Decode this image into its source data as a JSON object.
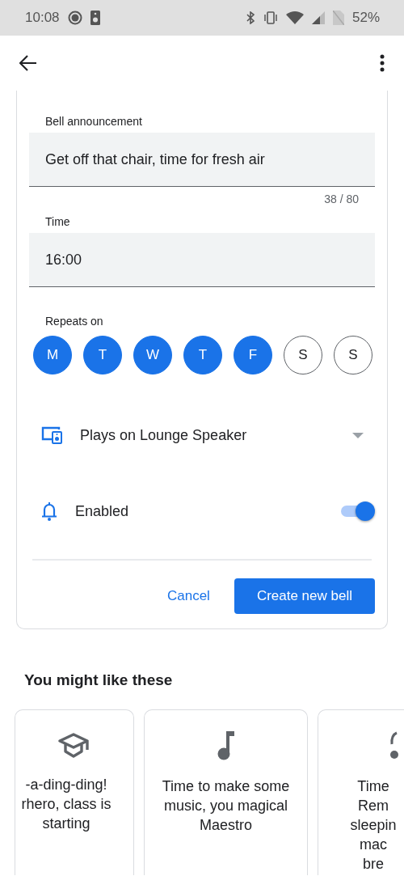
{
  "status_bar": {
    "time": "10:08",
    "battery": "52%"
  },
  "form": {
    "announcement": {
      "label": "Bell announcement",
      "value": "Get off that chair, time for fresh air",
      "counter": "38 / 80"
    },
    "time": {
      "label": "Time",
      "value": "16:00"
    },
    "repeats": {
      "label": "Repeats on",
      "days": [
        {
          "label": "M",
          "selected": true
        },
        {
          "label": "T",
          "selected": true
        },
        {
          "label": "W",
          "selected": true
        },
        {
          "label": "T",
          "selected": true
        },
        {
          "label": "F",
          "selected": true
        },
        {
          "label": "S",
          "selected": false
        },
        {
          "label": "S",
          "selected": false
        }
      ]
    },
    "speaker": {
      "label": "Plays on Lounge Speaker"
    },
    "enabled": {
      "label": "Enabled",
      "on": true
    },
    "buttons": [
      {
        "label": "Cancel",
        "kind": "text"
      },
      {
        "label": "Create new bell",
        "kind": "filled"
      }
    ]
  },
  "suggestions": {
    "title": "You might like these",
    "cards": [
      {
        "lines": [
          "-a-ding-ding!",
          "rhero, class is",
          "starting"
        ]
      },
      {
        "lines": [
          "Time to make some",
          "music, you magical",
          "Maestro"
        ]
      },
      {
        "lines": [
          "Time",
          "Rem",
          "sleepin",
          "mac",
          "bre"
        ]
      }
    ]
  }
}
